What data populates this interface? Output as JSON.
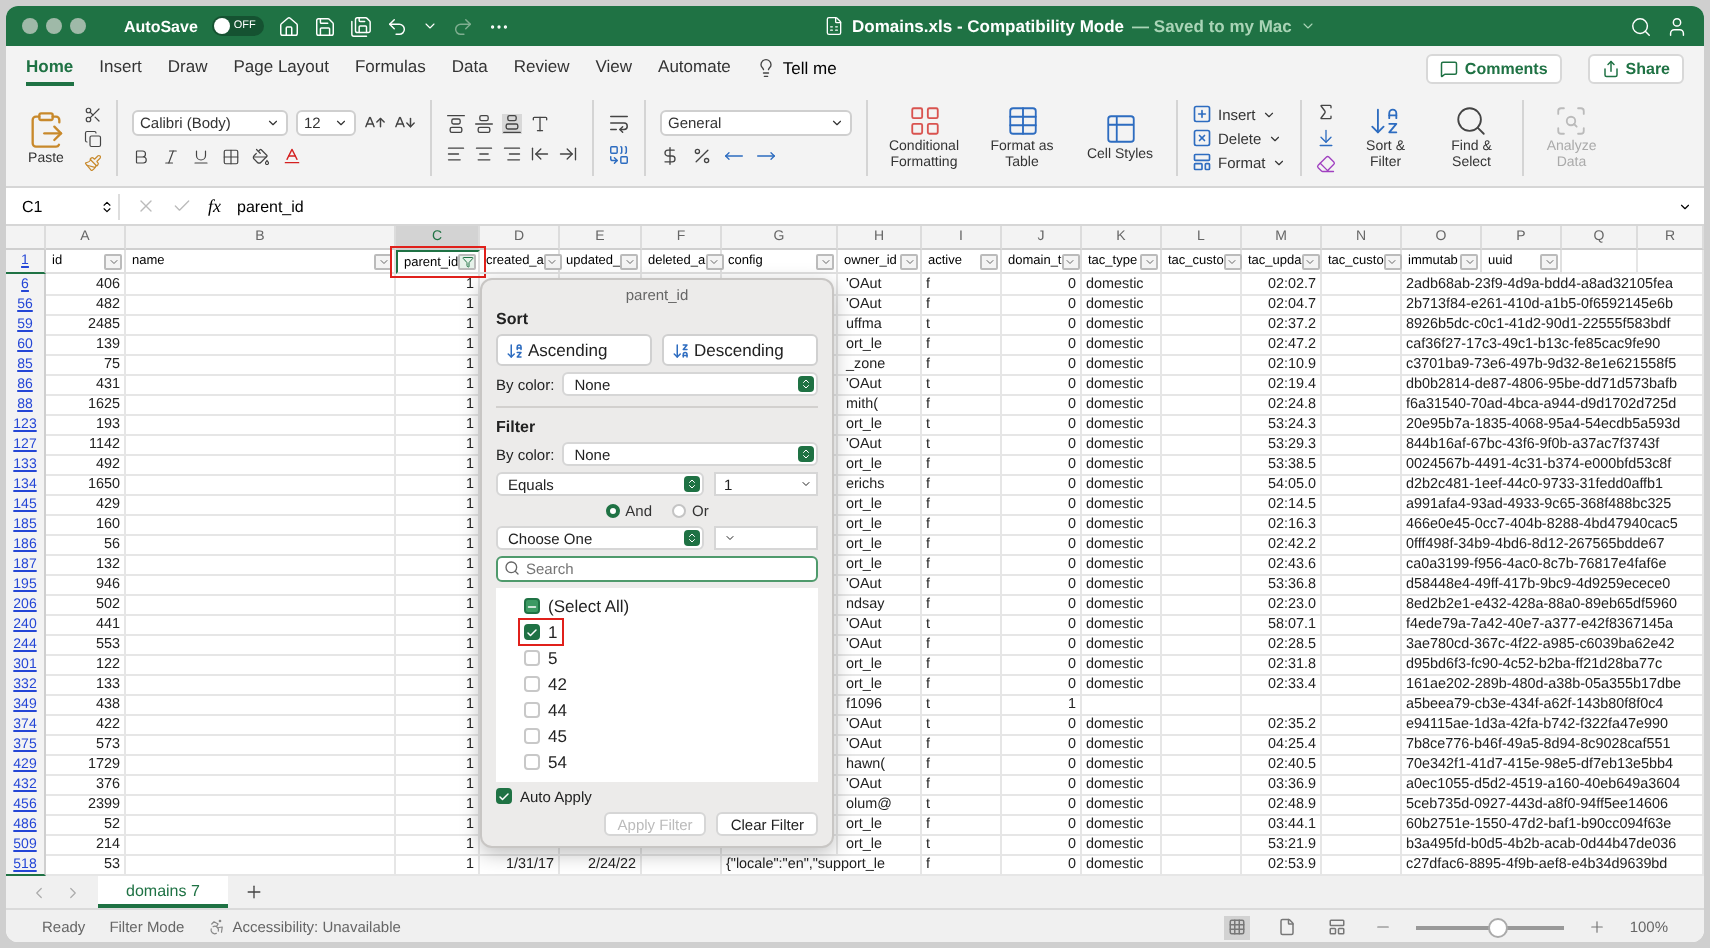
{
  "window": {
    "title": "Domains.xls - Compatibility Mode",
    "save_status": "— Saved to my Mac",
    "autosave": {
      "label": "AutoSave",
      "on": false,
      "state_text": "OFF"
    }
  },
  "ribbon_tabs": [
    {
      "label": "Home",
      "selected": true
    },
    {
      "label": "Insert",
      "selected": false
    },
    {
      "label": "Draw",
      "selected": false
    },
    {
      "label": "Page Layout",
      "selected": false
    },
    {
      "label": "Formulas",
      "selected": false
    },
    {
      "label": "Data",
      "selected": false
    },
    {
      "label": "Review",
      "selected": false
    },
    {
      "label": "View",
      "selected": false
    },
    {
      "label": "Automate",
      "selected": false
    }
  ],
  "tell_me": "Tell me",
  "comments": "Comments",
  "share": "Share",
  "ribbon": {
    "paste": "Paste",
    "font_name": "Calibri (Body)",
    "font_size": "12",
    "number_format": "General",
    "style_buttons": [
      "Conditional Formatting",
      "Format as Table",
      "Cell Styles"
    ],
    "cell_buttons": [
      "Insert",
      "Delete",
      "Format"
    ],
    "edit_buttons": [
      "Sort & Filter",
      "Find & Select"
    ],
    "analyze": {
      "label": "Analyze Data",
      "disabled": true
    }
  },
  "formula_bar": {
    "name_box": "C1",
    "fx": "fx",
    "formula": "parent_id"
  },
  "column_letters": [
    {
      "label": "A",
      "selected": false
    },
    {
      "label": "B",
      "selected": false
    },
    {
      "label": "C",
      "selected": true
    },
    {
      "label": "D",
      "selected": false
    },
    {
      "label": "E",
      "selected": false
    },
    {
      "label": "F",
      "selected": false
    },
    {
      "label": "G",
      "selected": false
    },
    {
      "label": "H",
      "selected": false
    },
    {
      "label": "I",
      "selected": false
    },
    {
      "label": "J",
      "selected": false
    },
    {
      "label": "K",
      "selected": false
    },
    {
      "label": "L",
      "selected": false
    },
    {
      "label": "M",
      "selected": false
    },
    {
      "label": "N",
      "selected": false
    },
    {
      "label": "O",
      "selected": false
    },
    {
      "label": "P",
      "selected": false
    },
    {
      "label": "Q",
      "selected": false
    },
    {
      "label": "R",
      "selected": false
    }
  ],
  "header_row": {
    "number": "1",
    "cells": [
      {
        "text": "id",
        "filtered": false,
        "selected": false,
        "highlighted": false
      },
      {
        "text": "name",
        "filtered": false,
        "selected": false,
        "highlighted": false
      },
      {
        "text": "parent_id",
        "filtered": true,
        "selected": true,
        "highlighted": true
      },
      {
        "text": "created_a",
        "filtered": false,
        "selected": false,
        "highlighted": false
      },
      {
        "text": "updated_",
        "filtered": false,
        "selected": false,
        "highlighted": false
      },
      {
        "text": "deleted_a",
        "filtered": false,
        "selected": false,
        "highlighted": false
      },
      {
        "text": "config",
        "filtered": false,
        "selected": false,
        "highlighted": false
      },
      {
        "text": "owner_id",
        "filtered": false,
        "selected": false,
        "highlighted": false
      },
      {
        "text": "active",
        "filtered": false,
        "selected": false,
        "highlighted": false
      },
      {
        "text": "domain_t",
        "filtered": false,
        "selected": false,
        "highlighted": false
      },
      {
        "text": "tac_type",
        "filtered": false,
        "selected": false,
        "highlighted": false
      },
      {
        "text": "tac_custo",
        "filtered": false,
        "selected": false,
        "highlighted": false
      },
      {
        "text": "tac_upda",
        "filtered": false,
        "selected": false,
        "highlighted": false
      },
      {
        "text": "tac_custo",
        "filtered": false,
        "selected": false,
        "highlighted": false
      },
      {
        "text": "immutab",
        "filtered": false,
        "selected": false,
        "highlighted": false
      },
      {
        "text": "uuid",
        "filtered": false,
        "selected": false,
        "highlighted": false
      }
    ]
  },
  "rows": [
    {
      "number": "6",
      "id": "406",
      "parent_id": "1",
      "owner": "'OAut",
      "active": "f",
      "domain": "0",
      "tac_type": "domestic",
      "tac_updated": "02:02.7",
      "uuid": "2adb68ab-23f9-4d9a-bdd4-a8ad32105fea"
    },
    {
      "number": "56",
      "id": "482",
      "parent_id": "1",
      "owner": "'OAut",
      "active": "f",
      "domain": "0",
      "tac_type": "domestic",
      "tac_updated": "02:04.7",
      "uuid": "2b713f84-e261-410d-a1b5-0f6592145e6b"
    },
    {
      "number": "59",
      "id": "2485",
      "parent_id": "1",
      "owner": "uffma",
      "active": "t",
      "domain": "0",
      "tac_type": "domestic",
      "tac_updated": "02:37.2",
      "uuid": "8926b5dc-c0c1-41d2-90d1-22555f583bdf"
    },
    {
      "number": "60",
      "id": "139",
      "parent_id": "1",
      "owner": "ort_le",
      "active": "f",
      "domain": "0",
      "tac_type": "domestic",
      "tac_updated": "02:47.2",
      "uuid": "caf36f27-17c3-49c1-b13c-fe85cac9fe90"
    },
    {
      "number": "85",
      "id": "75",
      "parent_id": "1",
      "owner": "_zone",
      "active": "f",
      "domain": "0",
      "tac_type": "domestic",
      "tac_updated": "02:10.9",
      "uuid": "c3701ba9-73e6-497b-9d32-8e1e621558f5"
    },
    {
      "number": "86",
      "id": "431",
      "parent_id": "1",
      "owner": "'OAut",
      "active": "t",
      "domain": "0",
      "tac_type": "domestic",
      "tac_updated": "02:19.4",
      "uuid": "db0b2814-de87-4806-95be-dd71d573bafb"
    },
    {
      "number": "88",
      "id": "1625",
      "parent_id": "1",
      "owner": "mith(",
      "active": "f",
      "domain": "0",
      "tac_type": "domestic",
      "tac_updated": "02:24.8",
      "uuid": "f6a31540-70ad-4bca-a944-d9d1702d725d"
    },
    {
      "number": "123",
      "id": "193",
      "parent_id": "1",
      "owner": "ort_le",
      "active": "t",
      "domain": "0",
      "tac_type": "domestic",
      "tac_updated": "53:24.3",
      "uuid": "20e95b7a-1835-4068-95a4-54ecdb5a593d"
    },
    {
      "number": "127",
      "id": "1142",
      "parent_id": "1",
      "owner": "'OAut",
      "active": "t",
      "domain": "0",
      "tac_type": "domestic",
      "tac_updated": "53:29.3",
      "uuid": "844b16af-67bc-43f6-9f0b-a37ac7f3743f"
    },
    {
      "number": "133",
      "id": "492",
      "parent_id": "1",
      "owner": "ort_le",
      "active": "f",
      "domain": "0",
      "tac_type": "domestic",
      "tac_updated": "53:38.5",
      "uuid": "0024567b-4491-4c31-b374-e000bfd53c8f"
    },
    {
      "number": "134",
      "id": "1650",
      "parent_id": "1",
      "owner": "erichs",
      "active": "f",
      "domain": "0",
      "tac_type": "domestic",
      "tac_updated": "54:05.0",
      "uuid": "d2b2c481-1eef-44c0-9733-31fedd0affb1"
    },
    {
      "number": "145",
      "id": "429",
      "parent_id": "1",
      "owner": "ort_le",
      "active": "f",
      "domain": "0",
      "tac_type": "domestic",
      "tac_updated": "02:14.5",
      "uuid": "a991afa4-93ad-4933-9c65-368f488bc325"
    },
    {
      "number": "185",
      "id": "160",
      "parent_id": "1",
      "owner": "ort_le",
      "active": "f",
      "domain": "0",
      "tac_type": "domestic",
      "tac_updated": "02:16.3",
      "uuid": "466e0e45-0cc7-404b-8288-4bd47940cac5"
    },
    {
      "number": "186",
      "id": "56",
      "parent_id": "1",
      "owner": "ort_le",
      "active": "f",
      "domain": "0",
      "tac_type": "domestic",
      "tac_updated": "02:42.2",
      "uuid": "0fff498f-34b9-4bd6-8d12-267565bdde67"
    },
    {
      "number": "187",
      "id": "132",
      "parent_id": "1",
      "owner": "ort_le",
      "active": "f",
      "domain": "0",
      "tac_type": "domestic",
      "tac_updated": "02:43.6",
      "uuid": "ca0a3199-f956-4ac0-8c7b-76817e4faf6e"
    },
    {
      "number": "195",
      "id": "946",
      "parent_id": "1",
      "owner": "'OAut",
      "active": "f",
      "domain": "0",
      "tac_type": "domestic",
      "tac_updated": "53:36.8",
      "uuid": "d58448e4-49ff-417b-9bc9-4d9259ecece0"
    },
    {
      "number": "206",
      "id": "502",
      "parent_id": "1",
      "owner": "ndsay",
      "active": "f",
      "domain": "0",
      "tac_type": "domestic",
      "tac_updated": "02:23.0",
      "uuid": "8ed2b2e1-e432-428a-88a0-89eb65df5960"
    },
    {
      "number": "240",
      "id": "441",
      "parent_id": "1",
      "owner": "'OAut",
      "active": "t",
      "domain": "0",
      "tac_type": "domestic",
      "tac_updated": "58:07.1",
      "uuid": "f4ede79a-7a42-40e7-a377-e42f8367145a"
    },
    {
      "number": "244",
      "id": "553",
      "parent_id": "1",
      "owner": "'OAut",
      "active": "f",
      "domain": "0",
      "tac_type": "domestic",
      "tac_updated": "02:28.5",
      "uuid": "3ae780cd-367c-4f22-a985-c6039ba62e42"
    },
    {
      "number": "301",
      "id": "122",
      "parent_id": "1",
      "owner": "ort_le",
      "active": "f",
      "domain": "0",
      "tac_type": "domestic",
      "tac_updated": "02:31.8",
      "uuid": "d95bd6f3-fc90-4c52-b2ba-ff21d28ba77c"
    },
    {
      "number": "332",
      "id": "133",
      "parent_id": "1",
      "owner": "ort_le",
      "active": "f",
      "domain": "0",
      "tac_type": "domestic",
      "tac_updated": "02:33.4",
      "uuid": "161ae202-289b-480d-a38b-05a355b17dbe"
    },
    {
      "number": "349",
      "id": "438",
      "parent_id": "1",
      "owner": "f1096",
      "active": "t",
      "domain": "1",
      "uuid": "a5beea79-cb3e-434f-a62f-143b80f8f0c4"
    },
    {
      "number": "374",
      "id": "422",
      "parent_id": "1",
      "owner": "'OAut",
      "active": "t",
      "domain": "0",
      "tac_type": "domestic",
      "tac_updated": "02:35.2",
      "uuid": "e94115ae-1d3a-42fa-b742-f322fa47e990"
    },
    {
      "number": "375",
      "id": "573",
      "parent_id": "1",
      "owner": "'OAut",
      "active": "f",
      "domain": "0",
      "tac_type": "domestic",
      "tac_updated": "04:25.4",
      "uuid": "7b8ce776-b46f-49a5-8d94-8c9028caf551"
    },
    {
      "number": "429",
      "id": "1729",
      "parent_id": "1",
      "owner": "hawn(",
      "active": "f",
      "domain": "0",
      "tac_type": "domestic",
      "tac_updated": "02:40.5",
      "uuid": "70e342f1-41d7-415e-98e5-df7eb13e5bb4"
    },
    {
      "number": "432",
      "id": "376",
      "parent_id": "1",
      "owner": "'OAut",
      "active": "f",
      "domain": "0",
      "tac_type": "domestic",
      "tac_updated": "03:36.9",
      "uuid": "a0ec1055-d5d2-4519-a160-40eb649a3604"
    },
    {
      "number": "456",
      "id": "2399",
      "parent_id": "1",
      "owner": "olum@",
      "active": "t",
      "domain": "0",
      "tac_type": "domestic",
      "tac_updated": "02:48.9",
      "uuid": "5ceb735d-0927-443d-a8f0-94ff5ee14606"
    },
    {
      "number": "486",
      "id": "52",
      "parent_id": "1",
      "owner": "ort_le",
      "active": "f",
      "domain": "0",
      "tac_type": "domestic",
      "tac_updated": "03:44.1",
      "uuid": "60b2751e-1550-47d2-baf1-b90cc094f63e"
    },
    {
      "number": "509",
      "id": "214",
      "parent_id": "1",
      "owner": "ort_le",
      "active": "t",
      "domain": "0",
      "tac_type": "domestic",
      "tac_updated": "53:21.9",
      "uuid": "b3a495fd-b0d5-4b2b-acab-0d44b47de036"
    },
    {
      "number": "518",
      "id": "53",
      "parent_id": "1",
      "created": "1/31/17",
      "updated": "2/24/22",
      "config": "{\"locale\":\"en\",\"support_le",
      "active": "f",
      "domain": "0",
      "tac_type": "domestic",
      "tac_updated": "02:53.9",
      "uuid": "c27dfac6-8895-4f9b-aef8-e4b34d9639bd"
    }
  ],
  "filter_popup": {
    "title": "parent_id",
    "sort_label": "Sort",
    "sort_buttons": [
      {
        "label": "Ascending",
        "kind": "ascending"
      },
      {
        "label": "Descending",
        "kind": "descending"
      }
    ],
    "sort_by_color": {
      "label": "By color:",
      "value": "None"
    },
    "filter_label": "Filter",
    "filter_by_color": {
      "label": "By color:",
      "value": "None"
    },
    "criteria": [
      {
        "operator": "Equals",
        "value": "1"
      },
      {
        "operator": "Choose One"
      }
    ],
    "logic": [
      {
        "label": "And",
        "selected": true
      },
      {
        "label": "Or",
        "selected": false
      }
    ],
    "search": {
      "placeholder": "Search"
    },
    "values": [
      {
        "label": "(Select All)",
        "checked": false,
        "mixed": true,
        "highlighted": false
      },
      {
        "label": "1",
        "checked": true,
        "mixed": false,
        "highlighted": true
      },
      {
        "label": "5",
        "checked": false,
        "mixed": false,
        "highlighted": false
      },
      {
        "label": "42",
        "checked": false,
        "mixed": false,
        "highlighted": false
      },
      {
        "label": "44",
        "checked": false,
        "mixed": false,
        "highlighted": false
      },
      {
        "label": "45",
        "checked": false,
        "mixed": false,
        "highlighted": false
      },
      {
        "label": "54",
        "checked": false,
        "mixed": false,
        "highlighted": false
      }
    ],
    "auto_apply": {
      "label": "Auto Apply",
      "checked": true
    },
    "buttons": [
      {
        "label": "Apply Filter",
        "disabled": true
      },
      {
        "label": "Clear Filter",
        "disabled": false
      }
    ]
  },
  "sheet_tabs": [
    {
      "label": "domains 7",
      "selected": true
    }
  ],
  "status_bar": {
    "items": [
      "Ready",
      "Filter Mode",
      "Accessibility: Unavailable"
    ],
    "views": [
      {
        "kind": "normal",
        "selected": true
      },
      {
        "kind": "page_layout",
        "selected": false
      },
      {
        "kind": "page_break",
        "selected": false
      }
    ],
    "zoom": {
      "level": 0.55,
      "text": "100%"
    }
  }
}
